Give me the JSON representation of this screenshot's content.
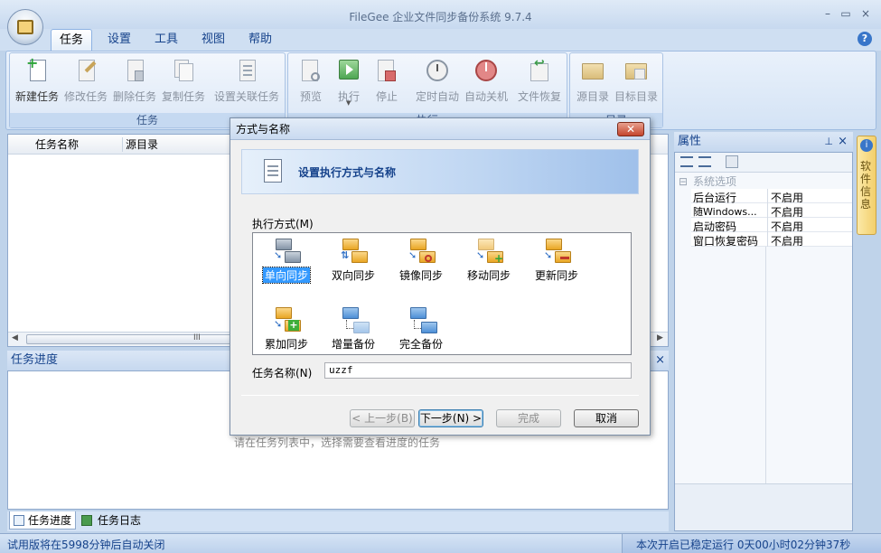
{
  "window": {
    "title": "FileGee 企业文件同步备份系统 9.7.4",
    "minimize": "–",
    "maximize": "▭",
    "close": "×"
  },
  "tabs": [
    {
      "label": "任务",
      "active": true
    },
    {
      "label": "设置"
    },
    {
      "label": "工具"
    },
    {
      "label": "视图"
    },
    {
      "label": "帮助"
    }
  ],
  "help_icon": "?",
  "ribbon": {
    "groups": [
      {
        "label": "任务"
      },
      {
        "label": "执行"
      },
      {
        "label": "目录"
      }
    ],
    "buttons": [
      {
        "label": "新建任务",
        "icon": "new-task-icon",
        "enabled": true
      },
      {
        "label": "修改任务",
        "icon": "edit-task-icon",
        "enabled": false
      },
      {
        "label": "删除任务",
        "icon": "delete-task-icon",
        "enabled": false
      },
      {
        "label": "复制任务",
        "icon": "copy-task-icon",
        "enabled": false
      },
      {
        "label": "设置关联任务",
        "icon": "link-task-icon",
        "enabled": false
      },
      {
        "label": "预览",
        "icon": "preview-icon",
        "enabled": false
      },
      {
        "label": "执行",
        "icon": "run-icon",
        "enabled": false
      },
      {
        "label": "停止",
        "icon": "stop-icon",
        "enabled": false
      },
      {
        "label": "定时自动",
        "icon": "timer-icon",
        "enabled": false
      },
      {
        "label": "自动关机",
        "icon": "shutdown-icon",
        "enabled": false
      },
      {
        "label": "文件恢复",
        "icon": "restore-icon",
        "enabled": false
      },
      {
        "label": "源目录",
        "icon": "source-folder-icon",
        "enabled": false
      },
      {
        "label": "目标目录",
        "icon": "target-folder-icon",
        "enabled": false
      }
    ]
  },
  "task_list": {
    "columns": [
      "任务名称",
      "源目录"
    ],
    "scroll_grip": "III"
  },
  "progress_pane": {
    "title": "任务进度",
    "hint": "请在任务列表中，选择需要查看进度的任务",
    "close": "×"
  },
  "bottom_tabs": [
    {
      "label": "任务进度",
      "icon": "progress-tab-icon"
    },
    {
      "label": "任务日志",
      "icon": "log-tab-icon"
    }
  ],
  "properties": {
    "title": "属性",
    "pin": "⊥",
    "close": "×",
    "category": "系统选项",
    "collapse": "⊟",
    "rows": [
      {
        "name": "后台运行",
        "value": "不启用"
      },
      {
        "name": "随Windows...",
        "value": "不启用"
      },
      {
        "name": "启动密码",
        "value": "不启用"
      },
      {
        "name": "窗口恢复密码",
        "value": "不启用"
      }
    ]
  },
  "side_tab": {
    "label": "软件信息"
  },
  "status": {
    "left": "试用版将在5998分钟后自动关闭",
    "right": "本次开启已稳定运行 0天00小时02分钟37秒"
  },
  "dialog": {
    "title": "方式与名称",
    "close": "✕",
    "banner": "设置执行方式与名称",
    "mode_label": "执行方式(M)",
    "modes": [
      {
        "label": "单向同步",
        "selected": true
      },
      {
        "label": "双向同步"
      },
      {
        "label": "镜像同步"
      },
      {
        "label": "移动同步"
      },
      {
        "label": "更新同步"
      },
      {
        "label": "累加同步"
      },
      {
        "label": "增量备份"
      },
      {
        "label": "完全备份"
      }
    ],
    "name_label": "任务名称(N)",
    "name_value": "uzzf",
    "buttons": {
      "prev": "< 上一步(B)",
      "next": "下一步(N) >",
      "finish": "完成",
      "cancel": "取消"
    }
  }
}
